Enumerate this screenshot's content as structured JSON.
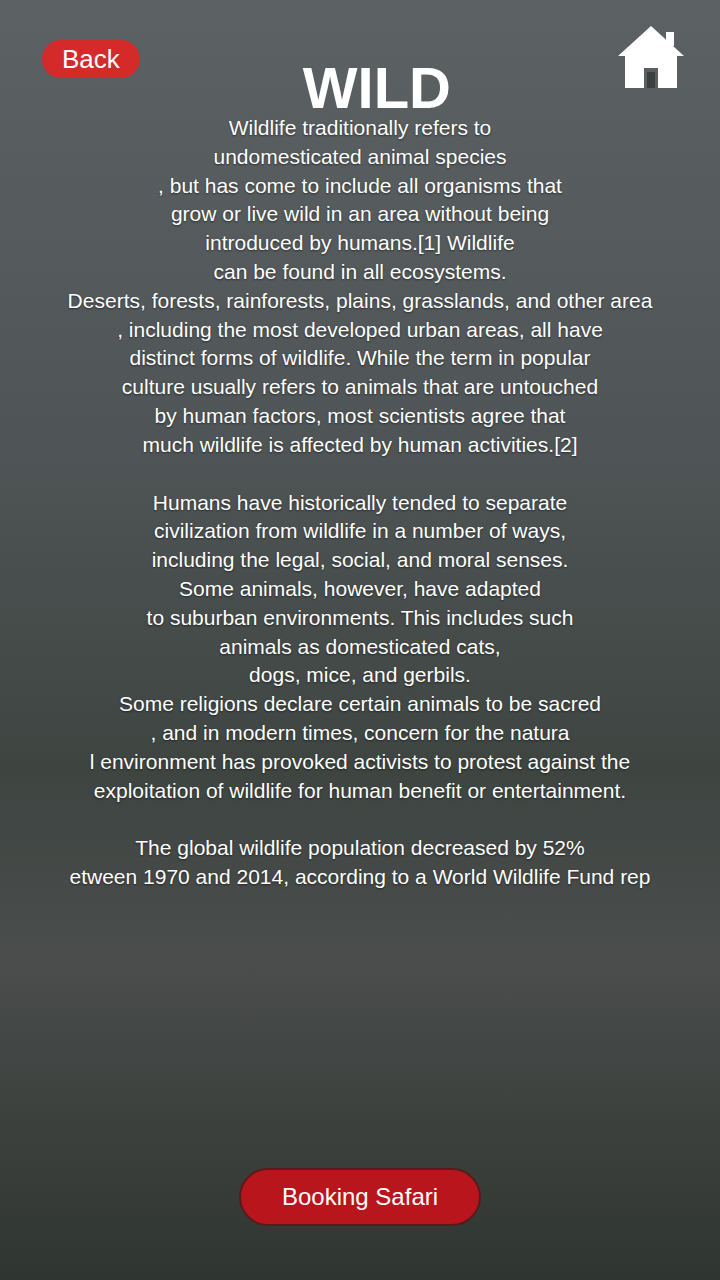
{
  "header": {
    "back": "Back",
    "title": "WILD"
  },
  "paragraphs": [
    {
      "lines": [
        "Wildlife traditionally refers to",
        "undomesticated animal species",
        ", but has come to include all organisms that",
        "grow or live wild in an area without being",
        "introduced by humans.[1] Wildlife",
        "can be found in all ecosystems.",
        "Deserts, forests, rainforests, plains, grasslands, and other area",
        ", including the most developed urban areas, all have",
        "distinct forms of wildlife. While the term in popular",
        "culture usually refers to animals that are untouched",
        "by human factors, most scientists agree that",
        "much wildlife is affected by human activities.[2]"
      ]
    },
    {
      "lines": [
        "Humans have historically tended to separate",
        "civilization from wildlife in a number of ways,",
        "including the legal, social, and moral senses.",
        "Some animals, however, have adapted",
        "to suburban environments. This includes such",
        "animals as domesticated cats,",
        "dogs, mice, and gerbils.",
        "Some religions declare certain animals to be sacred",
        ", and in modern times, concern for the natura",
        "l environment has provoked activists to protest against the",
        "exploitation of wildlife for human benefit or entertainment."
      ]
    },
    {
      "lines": [
        "The global wildlife population decreased by 52%",
        "etween 1970 and 2014, according to a World Wildlife Fund rep"
      ]
    }
  ],
  "button": "Booking Safari"
}
